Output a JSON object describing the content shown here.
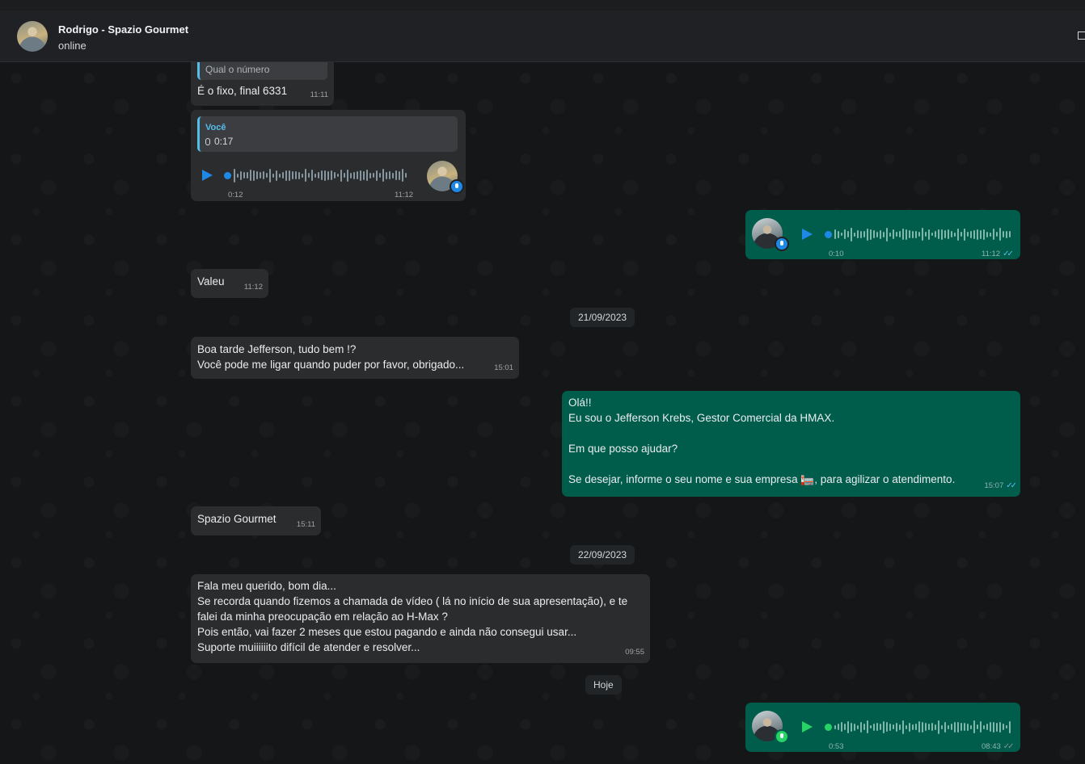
{
  "header": {
    "contact_name": "Rodrigo - Spazio Gourmet",
    "status": "online"
  },
  "messages": {
    "m1": {
      "quote_text": "Qual o número",
      "text": "É o fixo, final 6331",
      "time": "11:11"
    },
    "m2": {
      "quote_author": "Você",
      "quote_duration": "0:17",
      "duration": "0:12",
      "time": "11:12"
    },
    "m3": {
      "duration": "0:10",
      "time": "11:12"
    },
    "m4": {
      "text": "Valeu",
      "time": "11:12"
    },
    "m5": {
      "text": "Boa tarde Jefferson, tudo bem !?\nVocê pode me ligar quando puder por favor, obrigado...",
      "time": "15:01"
    },
    "m6": {
      "text": "Olá!!\nEu sou o Jefferson Krebs, Gestor Comercial da HMAX.\n\nEm que posso ajudar?\n\nSe desejar, informe o seu nome e sua empresa 🏣, para agilizar o atendimento.",
      "time": "15:07"
    },
    "m7": {
      "text": "Spazio Gourmet",
      "time": "15:11"
    },
    "m8": {
      "text": "Fala meu querido, bom dia...\nSe recorda quando fizemos a chamada de vídeo ( lá no início de sua apresentação), e te\nfalei da minha preocupação em relação ao H-Max ?\nPois então, vai fazer 2 meses que estou pagando e ainda não consegui usar...\nSuporte muiiiiiito difícil de atender e resolver...",
      "time": "09:55"
    },
    "m9": {
      "duration": "0:53",
      "time": "08:43"
    }
  },
  "dates": {
    "d1": "21/09/2023",
    "d2": "22/09/2023",
    "d3": "Hoje"
  },
  "colors": {
    "incoming_bubble": "#2b2c2e",
    "outgoing_bubble": "#005c4b",
    "accent_blue": "#53bdeb",
    "accent_green": "#25d366"
  }
}
